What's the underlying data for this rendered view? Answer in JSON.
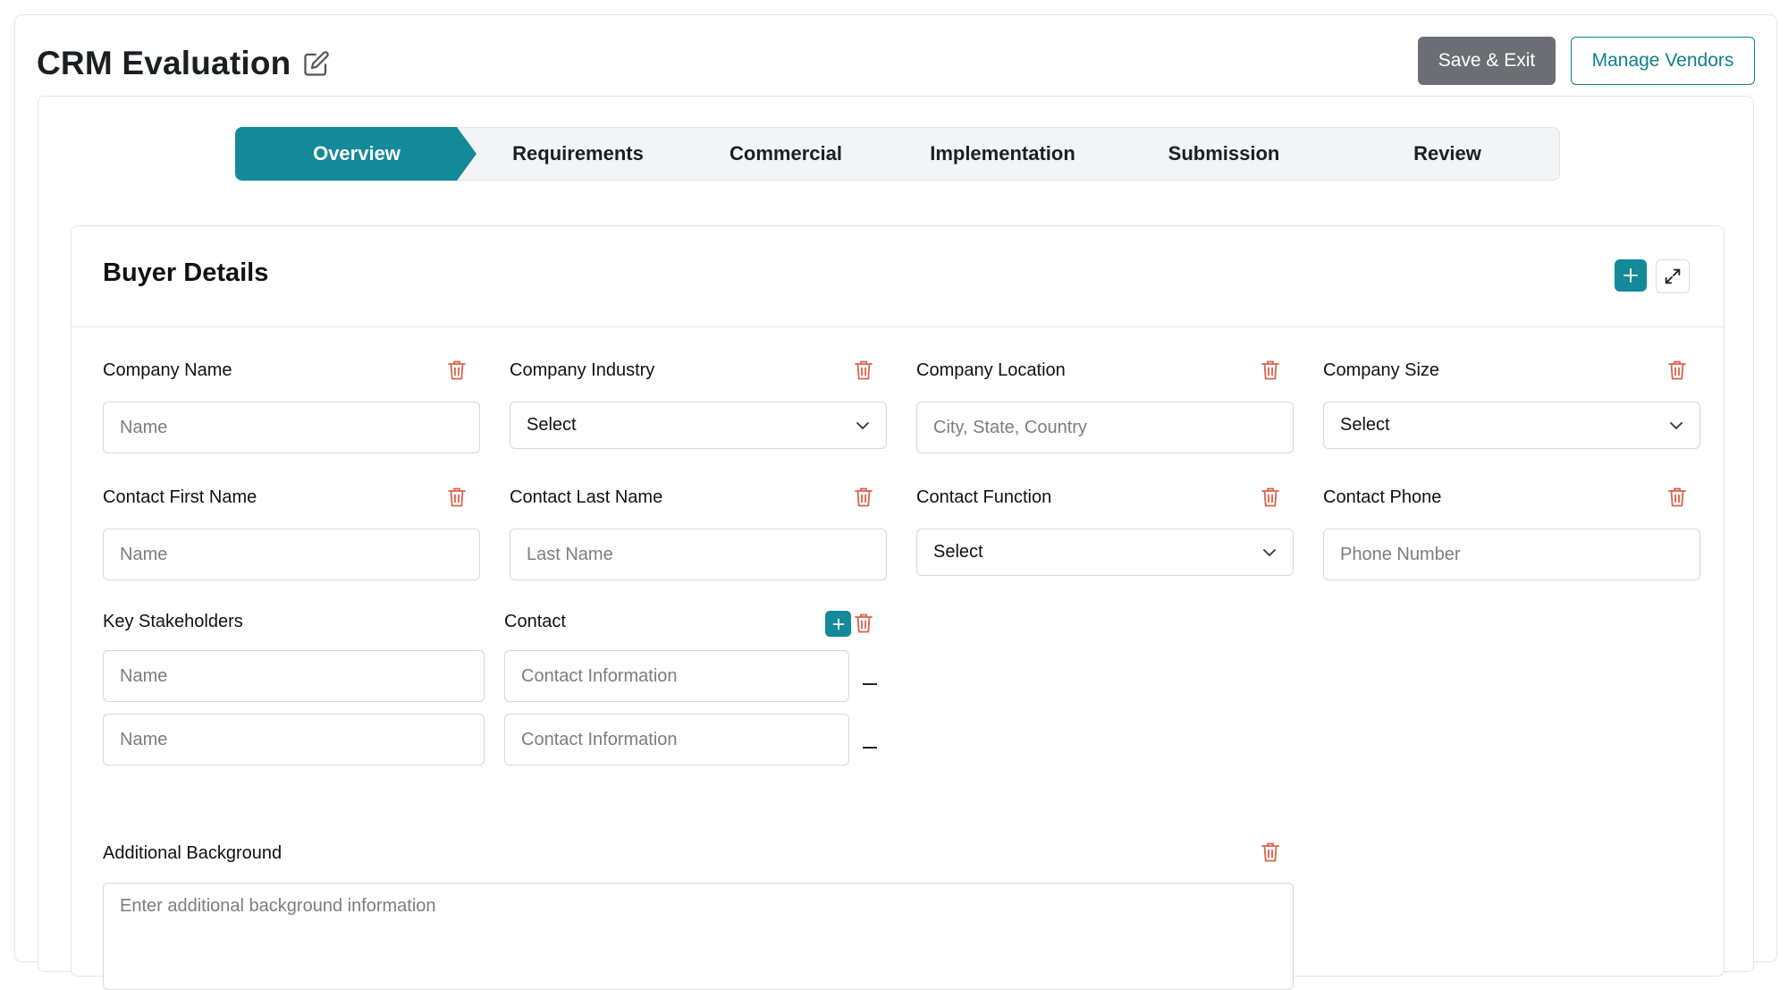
{
  "header": {
    "title": "CRM Evaluation",
    "save_exit_label": "Save & Exit",
    "manage_vendors_label": "Manage Vendors"
  },
  "stepper": {
    "active_index": 0,
    "steps": [
      "Overview",
      "Requirements",
      "Commercial",
      "Implementation",
      "Submission",
      "Review"
    ]
  },
  "section": {
    "title": "Buyer Details"
  },
  "fields": {
    "company_name": {
      "label": "Company Name",
      "placeholder": "Name"
    },
    "company_industry": {
      "label": "Company Industry",
      "value": "Select"
    },
    "company_location": {
      "label": "Company Location",
      "placeholder": "City, State, Country"
    },
    "company_size": {
      "label": "Company Size",
      "value": "Select"
    },
    "contact_first_name": {
      "label": "Contact First Name",
      "placeholder": "Name"
    },
    "contact_last_name": {
      "label": "Contact Last Name",
      "placeholder": "Last Name"
    },
    "contact_function": {
      "label": "Contact Function",
      "value": "Select"
    },
    "contact_phone": {
      "label": "Contact Phone",
      "placeholder": "Phone Number"
    },
    "stakeholders": {
      "name_label": "Key Stakeholders",
      "contact_label": "Contact",
      "rows": [
        {
          "name_placeholder": "Name",
          "contact_placeholder": "Contact Information"
        },
        {
          "name_placeholder": "Name",
          "contact_placeholder": "Contact Information"
        }
      ]
    },
    "additional_background": {
      "label": "Additional Background",
      "placeholder": "Enter additional background information"
    }
  },
  "colors": {
    "accent": "#13899a",
    "danger": "#d9634a",
    "save_button": "#6b6e73"
  }
}
